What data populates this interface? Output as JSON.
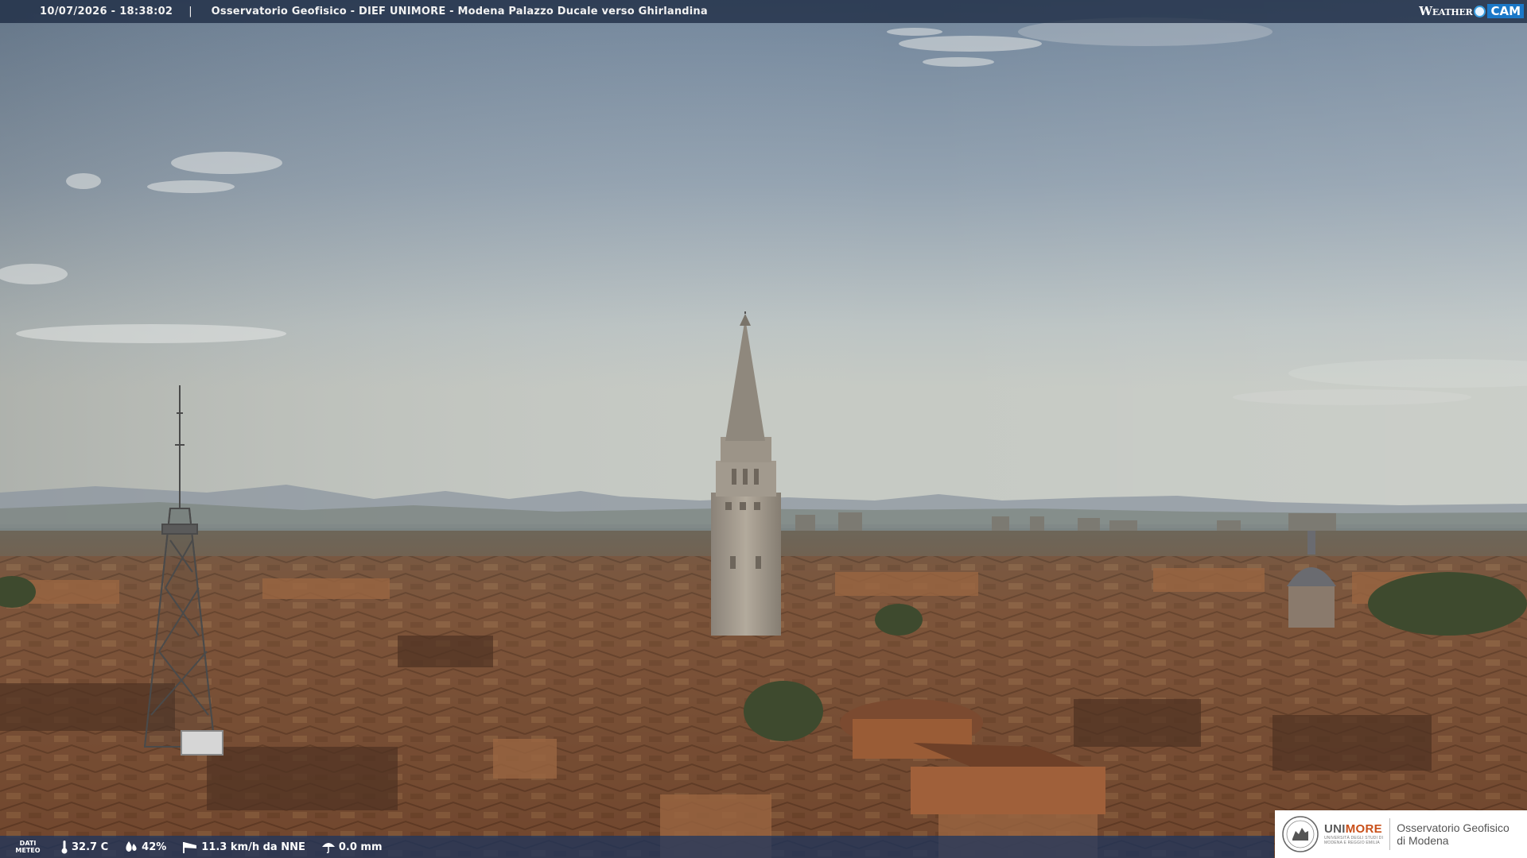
{
  "header": {
    "timestamp": "10/07/2026 - 18:38:02",
    "separator": "|",
    "title": "Osservatorio Geofisico - DIEF UNIMORE - Modena Palazzo Ducale verso Ghirlandina",
    "logo_left": "Weather",
    "logo_right": "CAM"
  },
  "weather": {
    "label_line1": "DATI",
    "label_line2": "METEO",
    "temperature": "32.7 C",
    "humidity": "42%",
    "wind": "11.3 km/h da NNE",
    "rain": "0.0 mm"
  },
  "branding": {
    "uni_prefix": "UNI",
    "uni_suffix": "MORE",
    "uni_subtitle_line1": "UNIVERSITÀ DEGLI STUDI DI",
    "uni_subtitle_line2": "MODENA E REGGIO EMILIA",
    "observatory_line1": "Osservatorio Geofisico",
    "observatory_line2": "di Modena"
  },
  "colors": {
    "sky_top": "#7c8fa4",
    "sky_horizon": "#c3c9c6",
    "roof": "#8a5a3a",
    "bar": "#1c2a42",
    "accent": "#c9501a"
  }
}
